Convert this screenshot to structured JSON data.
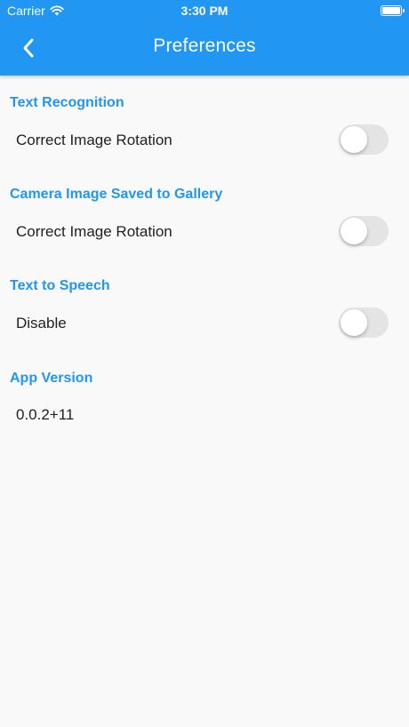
{
  "status_bar": {
    "carrier": "Carrier",
    "time": "3:30 PM"
  },
  "header": {
    "title": "Preferences"
  },
  "sections": [
    {
      "title": "Text Recognition",
      "row_label": "Correct Image Rotation",
      "toggle_on": false
    },
    {
      "title": "Camera Image Saved to Gallery",
      "row_label": "Correct Image Rotation",
      "toggle_on": false
    },
    {
      "title": "Text to Speech",
      "row_label": "Disable",
      "toggle_on": false
    },
    {
      "title": "App Version",
      "value": "0.0.2+11"
    }
  ],
  "colors": {
    "accent": "#2196f3",
    "background": "#f9f9f9",
    "toggle_off_track": "#e4e4e4"
  },
  "icons": {
    "back": "chevron-left-icon",
    "wifi": "wifi-icon",
    "battery": "battery-icon"
  }
}
